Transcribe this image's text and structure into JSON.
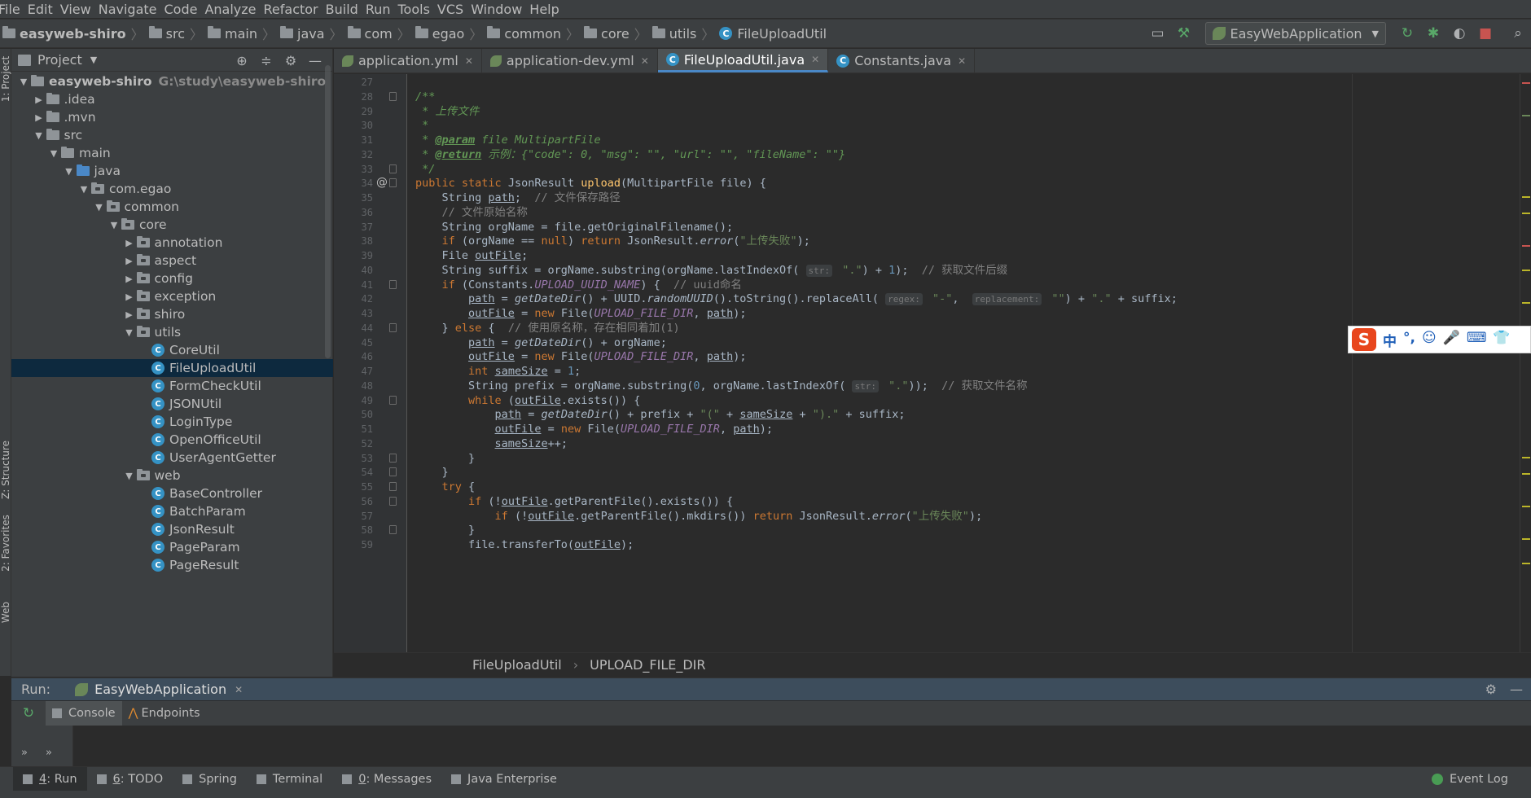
{
  "menu": [
    "File",
    "Edit",
    "View",
    "Navigate",
    "Code",
    "Analyze",
    "Refactor",
    "Build",
    "Run",
    "Tools",
    "VCS",
    "Window",
    "Help"
  ],
  "breadcrumb": [
    "easyweb-shiro",
    "src",
    "main",
    "java",
    "com",
    "egao",
    "common",
    "core",
    "utils",
    "FileUploadUtil"
  ],
  "run_config": "EasyWebApplication",
  "left_strip": {
    "project": "1: Project",
    "structure": "Z: Structure",
    "favorites": "2: Favorites",
    "web": "Web"
  },
  "project_panel": {
    "title": "Project",
    "tree": [
      {
        "label": "easyweb-shiro",
        "path": "G:\\study\\easyweb-shiro",
        "depth": 0,
        "arrow": "▼",
        "icon": "folder",
        "bold": true
      },
      {
        "label": ".idea",
        "depth": 1,
        "arrow": "▶",
        "icon": "folder"
      },
      {
        "label": ".mvn",
        "depth": 1,
        "arrow": "▶",
        "icon": "folder"
      },
      {
        "label": "src",
        "depth": 1,
        "arrow": "▼",
        "icon": "folder"
      },
      {
        "label": "main",
        "depth": 2,
        "arrow": "▼",
        "icon": "folder"
      },
      {
        "label": "java",
        "depth": 3,
        "arrow": "▼",
        "icon": "folder-blue"
      },
      {
        "label": "com.egao",
        "depth": 4,
        "arrow": "▼",
        "icon": "package"
      },
      {
        "label": "common",
        "depth": 5,
        "arrow": "▼",
        "icon": "package"
      },
      {
        "label": "core",
        "depth": 6,
        "arrow": "▼",
        "icon": "package"
      },
      {
        "label": "annotation",
        "depth": 7,
        "arrow": "▶",
        "icon": "package"
      },
      {
        "label": "aspect",
        "depth": 7,
        "arrow": "▶",
        "icon": "package"
      },
      {
        "label": "config",
        "depth": 7,
        "arrow": "▶",
        "icon": "package"
      },
      {
        "label": "exception",
        "depth": 7,
        "arrow": "▶",
        "icon": "package"
      },
      {
        "label": "shiro",
        "depth": 7,
        "arrow": "▶",
        "icon": "package"
      },
      {
        "label": "utils",
        "depth": 7,
        "arrow": "▼",
        "icon": "package"
      },
      {
        "label": "CoreUtil",
        "depth": 8,
        "arrow": "",
        "icon": "class"
      },
      {
        "label": "FileUploadUtil",
        "depth": 8,
        "arrow": "",
        "icon": "class",
        "selected": true
      },
      {
        "label": "FormCheckUtil",
        "depth": 8,
        "arrow": "",
        "icon": "class"
      },
      {
        "label": "JSONUtil",
        "depth": 8,
        "arrow": "",
        "icon": "class"
      },
      {
        "label": "LoginType",
        "depth": 8,
        "arrow": "",
        "icon": "class"
      },
      {
        "label": "OpenOfficeUtil",
        "depth": 8,
        "arrow": "",
        "icon": "class"
      },
      {
        "label": "UserAgentGetter",
        "depth": 8,
        "arrow": "",
        "icon": "class"
      },
      {
        "label": "web",
        "depth": 7,
        "arrow": "▼",
        "icon": "package"
      },
      {
        "label": "BaseController",
        "depth": 8,
        "arrow": "",
        "icon": "class"
      },
      {
        "label": "BatchParam",
        "depth": 8,
        "arrow": "",
        "icon": "class"
      },
      {
        "label": "JsonResult",
        "depth": 8,
        "arrow": "",
        "icon": "class"
      },
      {
        "label": "PageParam",
        "depth": 8,
        "arrow": "",
        "icon": "class"
      },
      {
        "label": "PageResult",
        "depth": 8,
        "arrow": "",
        "icon": "class"
      }
    ]
  },
  "editor_tabs": [
    {
      "label": "application.yml",
      "icon": "yml"
    },
    {
      "label": "application-dev.yml",
      "icon": "yml"
    },
    {
      "label": "FileUploadUtil.java",
      "icon": "class",
      "active": true
    },
    {
      "label": "Constants.java",
      "icon": "class"
    }
  ],
  "code": {
    "line_numbers": [
      "27",
      "28",
      "29",
      "30",
      "31",
      "32",
      "33",
      "34",
      "35",
      "36",
      "37",
      "38",
      "39",
      "40",
      "41",
      "42",
      "43",
      "44",
      "45",
      "46",
      "47",
      "48",
      "49",
      "50",
      "51",
      "52",
      "53",
      "54",
      "55",
      "56",
      "57",
      "58",
      "59"
    ],
    "lines": [
      "",
      "/**",
      " * 上传文件",
      " *",
      " * @param file MultipartFile",
      " * @return 示例：{\"code\": 0, \"msg\": \"\", \"url\": \"\", \"fileName\": \"\"}",
      " */",
      "public static JsonResult upload(MultipartFile file) {",
      "    String path;  // 文件保存路径",
      "    // 文件原始名称",
      "    String orgName = file.getOriginalFilename();",
      "    if (orgName == null) return JsonResult.error(\"上传失败\");",
      "    File outFile;",
      "    String suffix = orgName.substring(orgName.lastIndexOf( str: \".\") + 1);  // 获取文件后缀",
      "    if (Constants.UPLOAD_UUID_NAME) {  // uuid命名",
      "        path = getDateDir() + UUID.randomUUID().toString().replaceAll( regex: \"-\",  replacement: \"\") + \".\" + suffix;",
      "        outFile = new File(UPLOAD_FILE_DIR, path);",
      "    } else {  // 使用原名称，存在相同着加(1)",
      "        path = getDateDir() + orgName;",
      "        outFile = new File(UPLOAD_FILE_DIR, path);",
      "        int sameSize = 1;",
      "        String prefix = orgName.substring(0, orgName.lastIndexOf( str: \".\"));  // 获取文件名称",
      "        while (outFile.exists()) {",
      "            path = getDateDir() + prefix + \"(\" + sameSize + \").\" + suffix;",
      "            outFile = new File(UPLOAD_FILE_DIR, path);",
      "            sameSize++;",
      "        }",
      "    }",
      "    try {",
      "        if (!outFile.getParentFile().exists()) {",
      "            if (!outFile.getParentFile().mkdirs()) return JsonResult.error(\"上传失败\");",
      "        }",
      "        file.transferTo(outFile);"
    ]
  },
  "editor_breadcrumb": [
    "FileUploadUtil",
    "UPLOAD_FILE_DIR"
  ],
  "run_panel": {
    "label": "Run:",
    "tab": "EasyWebApplication",
    "subtabs": [
      "Console",
      "Endpoints"
    ]
  },
  "bottom_tools": [
    {
      "num": "4",
      "label": ": Run",
      "active": true
    },
    {
      "num": "6",
      "label": ": TODO"
    },
    {
      "num": "",
      "label": "Spring"
    },
    {
      "num": "",
      "label": "Terminal"
    },
    {
      "num": "0",
      "label": ": Messages"
    },
    {
      "num": "",
      "label": "Java Enterprise"
    }
  ],
  "event_log": "Event Log",
  "ime": {
    "logo": "S",
    "items": [
      "中",
      "°,",
      "☺",
      "🎤",
      "⌨",
      "👕"
    ]
  }
}
